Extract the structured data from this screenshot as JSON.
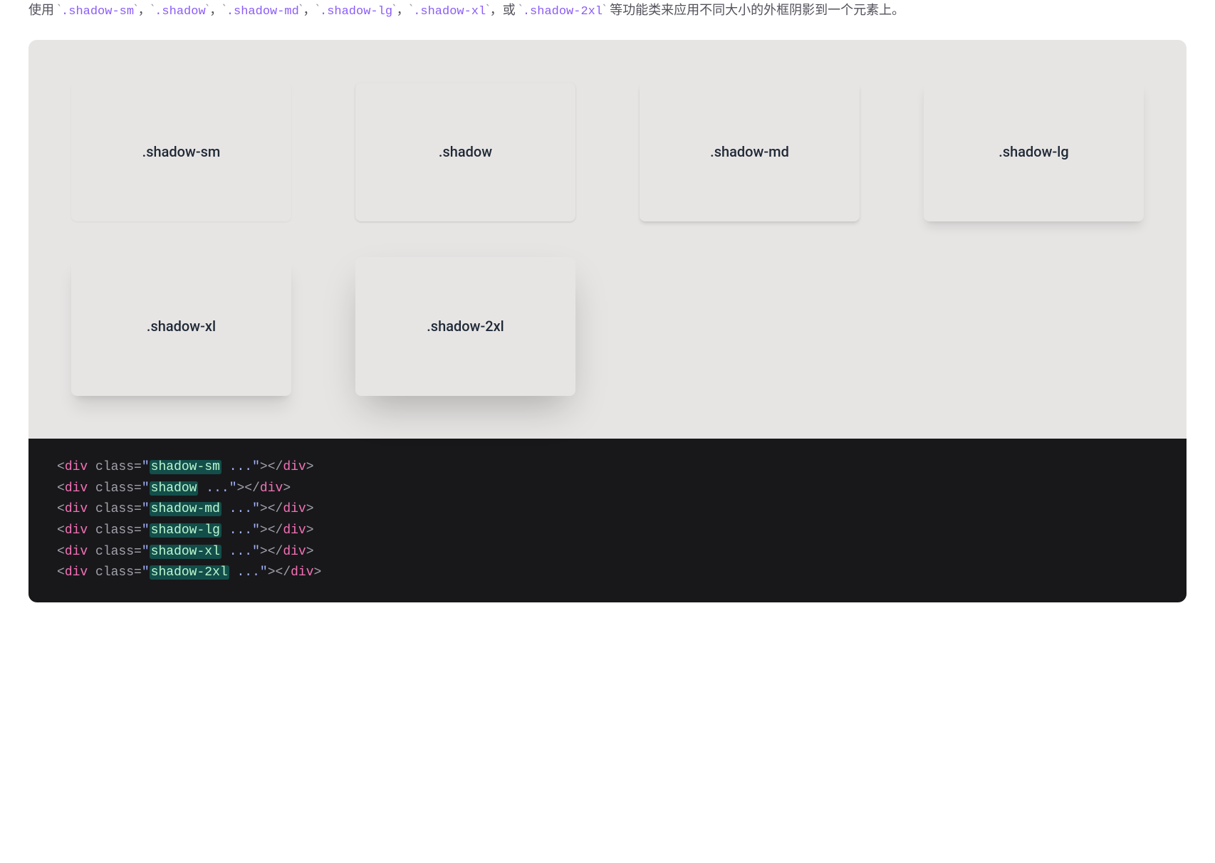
{
  "intro": {
    "prefix": "使用 ",
    "classes": [
      ".shadow-sm",
      ".shadow",
      ".shadow-md",
      ".shadow-lg",
      ".shadow-xl",
      ".shadow-2xl"
    ],
    "sep": "，",
    "lastSep": "，或 ",
    "suffix": " 等功能类来应用不同大小的外框阴影到一个元素上。"
  },
  "cards": [
    {
      "label": ".shadow-sm",
      "cls": "shadow-sm"
    },
    {
      "label": ".shadow",
      "cls": "shadow"
    },
    {
      "label": ".shadow-md",
      "cls": "shadow-md"
    },
    {
      "label": ".shadow-lg",
      "cls": "shadow-lg"
    },
    {
      "label": ".shadow-xl",
      "cls": "shadow-xl"
    },
    {
      "label": ".shadow-2xl",
      "cls": "shadow-2xl"
    }
  ],
  "code": {
    "tag": "div",
    "attr": "class",
    "rest": " ...",
    "lines": [
      "shadow-sm",
      "shadow",
      "shadow-md",
      "shadow-lg",
      "shadow-xl",
      "shadow-2xl"
    ]
  }
}
